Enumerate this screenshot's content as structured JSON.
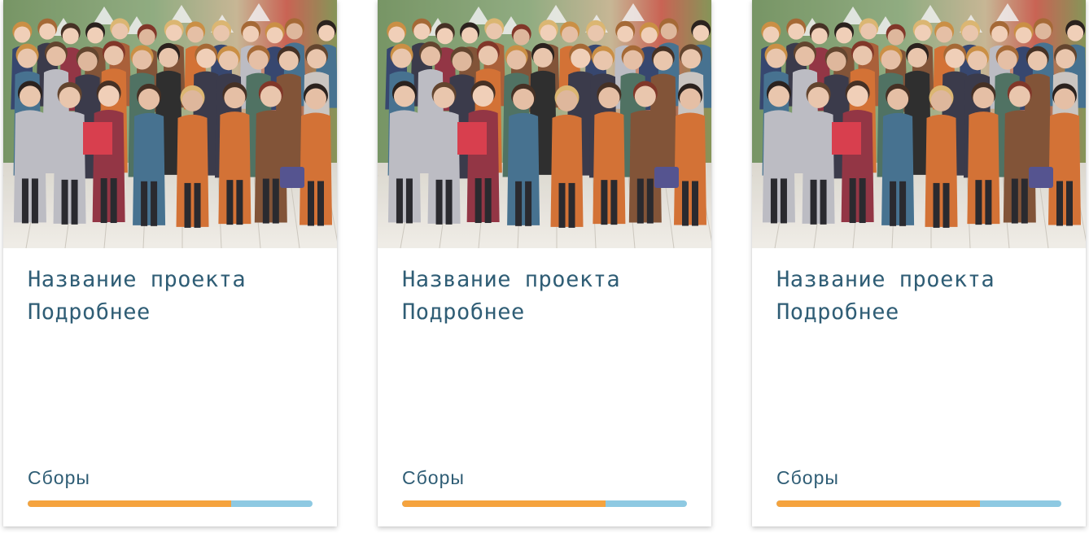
{
  "cards": [
    {
      "title": "Название проекта",
      "more_link": "Подробнее",
      "progress_label": "Сборы",
      "progress_fraction": 0.714,
      "image_alt": "group-photo"
    },
    {
      "title": "Название проекта",
      "more_link": "Подробнее",
      "progress_label": "Сборы",
      "progress_fraction": 0.714,
      "image_alt": "group-photo"
    },
    {
      "title": "Название проекта",
      "more_link": "Подробнее",
      "progress_label": "Сборы",
      "progress_fraction": 0.714,
      "image_alt": "group-photo"
    }
  ],
  "colors": {
    "text": "#2f5d75",
    "progress_filled": "#f5a33e",
    "progress_track": "#8ec9e2"
  }
}
